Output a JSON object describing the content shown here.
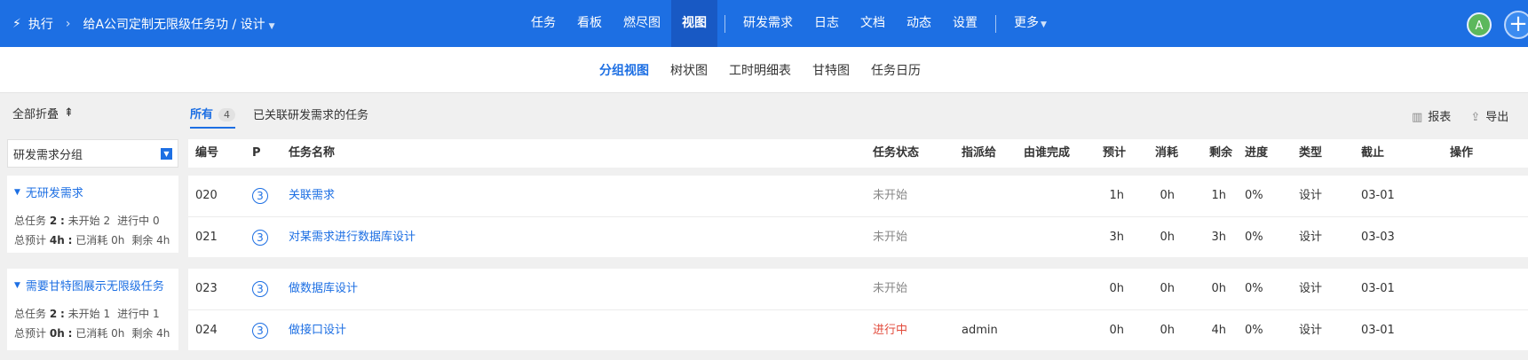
{
  "topbar": {
    "section": "执行",
    "breadcrumb": "给A公司定制无限级任务功 / 设计",
    "nav": [
      "任务",
      "看板",
      "燃尽图",
      "视图",
      "研发需求",
      "日志",
      "文档",
      "动态",
      "设置"
    ],
    "active_nav": "视图",
    "more": "更多",
    "avatar": "A",
    "plus": "+"
  },
  "subnav": {
    "items": [
      "分组视图",
      "树状图",
      "工时明细表",
      "甘特图",
      "任务日历"
    ],
    "active": "分组视图"
  },
  "left": {
    "collapse_all": "全部折叠",
    "group_select": "研发需求分组",
    "groups": [
      {
        "title": "无研发需求",
        "line1": {
          "total_label": "总任务",
          "total": "2",
          "wait_label": "未开始",
          "wait": "2",
          "doing_label": "进行中",
          "doing": "0"
        },
        "line2": {
          "est_label": "总预计",
          "est": "4h",
          "used_label": "已消耗",
          "used": "0h",
          "left_label": "剩余",
          "left": "4h"
        }
      },
      {
        "title": "需要甘特图展示无限级任务",
        "line1": {
          "total_label": "总任务",
          "total": "2",
          "wait_label": "未开始",
          "wait": "1",
          "doing_label": "进行中",
          "doing": "1"
        },
        "line2": {
          "est_label": "总预计",
          "est": "0h",
          "used_label": "已消耗",
          "used": "0h",
          "left_label": "剩余",
          "left": "4h"
        }
      }
    ]
  },
  "tabs": {
    "all": "所有",
    "all_count": "4",
    "linked": "已关联研发需求的任务"
  },
  "actions": {
    "report": "报表",
    "export": "导出"
  },
  "table": {
    "headers": {
      "id": "编号",
      "p": "P",
      "name": "任务名称",
      "status": "任务状态",
      "assignee": "指派给",
      "finished_by": "由谁完成",
      "estimate": "预计",
      "consumed": "消耗",
      "left": "剩余",
      "progress": "进度",
      "type": "类型",
      "deadline": "截止",
      "ops": "操作"
    },
    "rows": [
      {
        "id": "020",
        "p": "3",
        "name": "关联需求",
        "status": "未开始",
        "assignee": "",
        "finished_by": "",
        "estimate": "1h",
        "consumed": "0h",
        "left": "1h",
        "progress": "0%",
        "type": "设计",
        "deadline": "03-01"
      },
      {
        "id": "021",
        "p": "3",
        "name": "对某需求进行数据库设计",
        "status": "未开始",
        "assignee": "",
        "finished_by": "",
        "estimate": "3h",
        "consumed": "0h",
        "left": "3h",
        "progress": "0%",
        "type": "设计",
        "deadline": "03-03"
      },
      {
        "id": "023",
        "p": "3",
        "name": "做数据库设计",
        "status": "未开始",
        "assignee": "",
        "finished_by": "",
        "estimate": "0h",
        "consumed": "0h",
        "left": "0h",
        "progress": "0%",
        "type": "设计",
        "deadline": "03-01"
      },
      {
        "id": "024",
        "p": "3",
        "name": "做接口设计",
        "status": "进行中",
        "assignee": "admin",
        "finished_by": "",
        "estimate": "0h",
        "consumed": "0h",
        "left": "4h",
        "progress": "0%",
        "type": "设计",
        "deadline": "03-01"
      }
    ]
  }
}
